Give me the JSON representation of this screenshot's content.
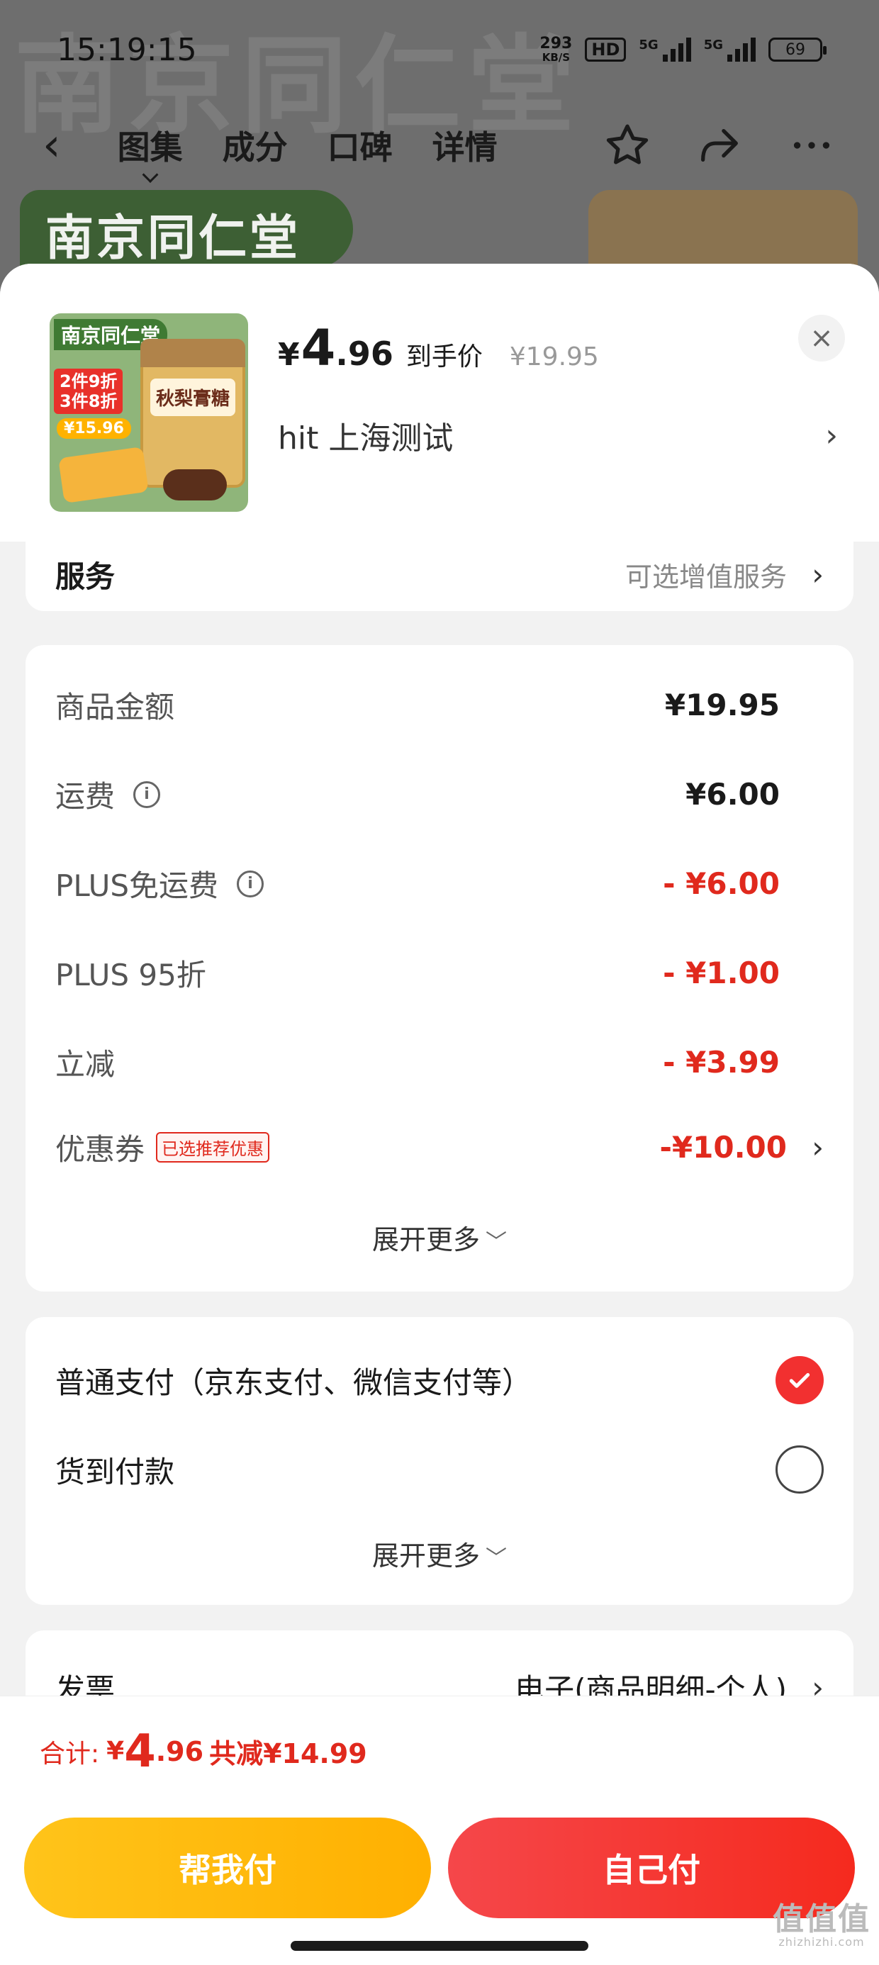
{
  "status_bar": {
    "time": "15:19:15",
    "speed_value": "293",
    "speed_unit": "KB/S",
    "hd": "HD",
    "sim1": "5G",
    "sim2": "5G",
    "battery": "69"
  },
  "background": {
    "watermark": "南京同仁堂",
    "tabs": [
      "图集",
      "成分",
      "口碑",
      "详情"
    ],
    "banner": "南京同仁堂"
  },
  "product": {
    "thumb_brand": "南京同仁堂",
    "thumb_promo_line1": "2件9折",
    "thumb_promo_line2": "3件8折",
    "thumb_price": "¥15.96",
    "thumb_jar_label": "秋梨膏糖",
    "price_yen": "¥",
    "price_int": "4",
    "price_dec": ".96",
    "price_tag": "到手价",
    "original_price": "¥19.95",
    "close_icon": "×",
    "sku": "hit  上海测试",
    "chevron": "›"
  },
  "service": {
    "label": "服务",
    "hint": "可选增值服务",
    "chevron": "›"
  },
  "amounts": {
    "rows": [
      {
        "label": "商品金额",
        "value": "¥19.95"
      },
      {
        "label": "运费",
        "value": "¥6.00",
        "info": "i"
      },
      {
        "label": "PLUS免运费",
        "value": "- ¥6.00",
        "info": "i"
      },
      {
        "label": "PLUS 95折",
        "value": "- ¥1.00"
      },
      {
        "label": "立减",
        "value": "- ¥3.99"
      },
      {
        "label": "优惠券",
        "value": "-¥10.00",
        "badge": "已选推荐优惠"
      }
    ],
    "expand": "展开更多",
    "expand_icon": "﹀"
  },
  "payment": {
    "options": [
      {
        "label": "普通支付（京东支付、微信支付等）",
        "selected": true
      },
      {
        "label": "货到付款",
        "selected": false
      }
    ],
    "expand": "展开更多",
    "expand_icon": "﹀"
  },
  "invoice": {
    "label": "发票",
    "value": "电子(商品明细-个人)",
    "chevron": "›"
  },
  "total": {
    "label": "合计:",
    "yen": "¥",
    "int": "4",
    "dec": ".96",
    "saved": "共减¥14.99"
  },
  "buttons": {
    "help_pay": "帮我付",
    "self_pay": "自己付"
  },
  "watermark": {
    "text": "值值值",
    "sub": "zhizhizhi.com"
  },
  "colors": {
    "accent_red": "#e0291d",
    "button_yellow": "#ffb000",
    "button_red": "#f52a1e"
  }
}
